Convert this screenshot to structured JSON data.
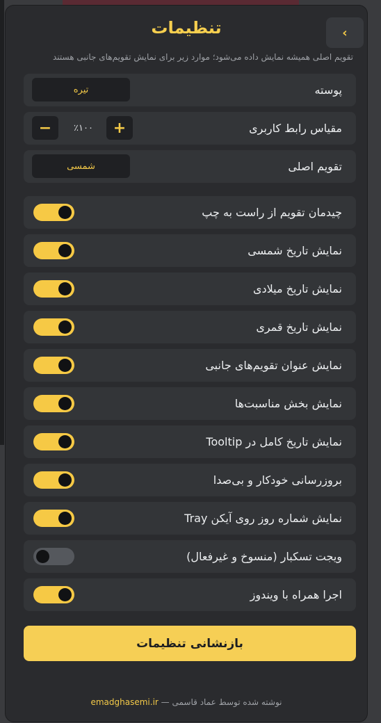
{
  "header": {
    "title": "تنظیمات",
    "back_icon": "‹",
    "subtitle": "تقویم اصلی همیشه نمایش داده می‌شود؛ موارد زیر برای نمایش تقویم‌های جانبی هستند"
  },
  "settings": {
    "theme": {
      "label": "پوسته",
      "value": "تیره"
    },
    "scale": {
      "label": "مقیاس رابط کاربری",
      "value": "٪۱۰۰",
      "minus": "−",
      "plus": "+"
    },
    "main_calendar": {
      "label": "تقویم اصلی",
      "value": "شمسی"
    },
    "toggles": [
      {
        "label": "چیدمان تقویم از راست به چپ",
        "on": true
      },
      {
        "label": "نمایش تاریخ شمسی",
        "on": true
      },
      {
        "label": "نمایش تاریخ میلادی",
        "on": true
      },
      {
        "label": "نمایش تاریخ قمری",
        "on": true
      },
      {
        "label": "نمایش عنوان تقویم‌های جانبی",
        "on": true
      },
      {
        "label": "نمایش بخش مناسبت‌ها",
        "on": true
      },
      {
        "label": "نمایش تاریخ کامل در Tooltip",
        "on": true
      },
      {
        "label": "بروزرسانی خودکار و بی‌صدا",
        "on": true
      },
      {
        "label": "نمایش شماره روز روی آیکن Tray",
        "on": true
      },
      {
        "label": "ویجت تسکبار (منسوخ و غیرفعال)",
        "on": false
      },
      {
        "label": "اجرا همراه با ویندوز",
        "on": true
      }
    ]
  },
  "reset_button": "بازنشانی تنظیمات",
  "footer": {
    "text": "نوشته شده توسط عماد قاسمی —",
    "link": "emadghasemi.ir"
  },
  "colors": {
    "accent": "#f6c945",
    "panel": "#2a2b2e",
    "row": "#333538"
  }
}
